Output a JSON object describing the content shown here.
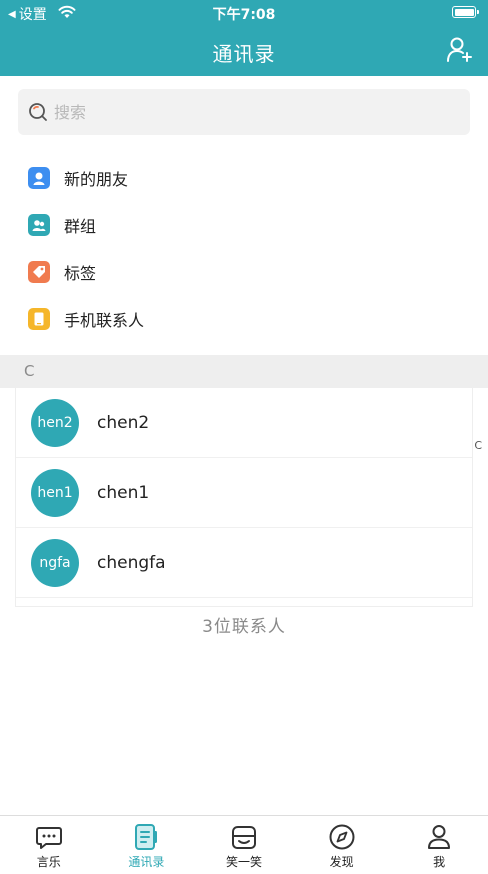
{
  "status_bar": {
    "back_label": "设置",
    "time": "下午7:08"
  },
  "nav": {
    "title": "通讯录",
    "add_icon": "add-user-icon"
  },
  "search": {
    "placeholder": "搜索"
  },
  "menu": {
    "items": [
      {
        "label": "新的朋友",
        "icon": "new-friend-icon",
        "color": "#3d8ef0"
      },
      {
        "label": "群组",
        "icon": "group-icon",
        "color": "#2fa8b4"
      },
      {
        "label": "标签",
        "icon": "tag-icon",
        "color": "#f07b4f"
      },
      {
        "label": "手机联系人",
        "icon": "phone-contacts-icon",
        "color": "#f5b62a"
      }
    ]
  },
  "section": {
    "letter": "C"
  },
  "contacts": [
    {
      "avatar_text": "hen2",
      "name": "chen2"
    },
    {
      "avatar_text": "hen1",
      "name": "chen1"
    },
    {
      "avatar_text": "ngfa",
      "name": "chengfa"
    }
  ],
  "index_bar": {
    "letter": "C"
  },
  "footer": {
    "count_label": "3位联系人"
  },
  "tabbar": {
    "tabs": [
      {
        "label": "言乐",
        "icon": "chat-icon",
        "active": false
      },
      {
        "label": "通讯录",
        "icon": "contacts-icon",
        "active": true
      },
      {
        "label": "笑一笑",
        "icon": "smile-icon",
        "active": false
      },
      {
        "label": "发现",
        "icon": "compass-icon",
        "active": false
      },
      {
        "label": "我",
        "icon": "person-icon",
        "active": false
      }
    ]
  },
  "colors": {
    "brand": "#2fa8b4",
    "section_bg": "#eeeeee",
    "muted_text": "#8a8a8a"
  }
}
